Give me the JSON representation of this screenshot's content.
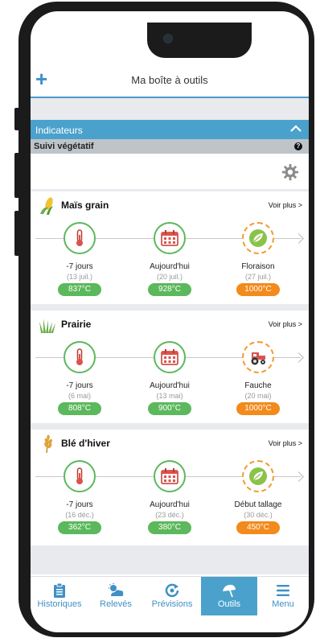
{
  "header": {
    "title": "Ma boîte à outils"
  },
  "section": {
    "title": "Indicateurs",
    "subtitle": "Suivi végétatif"
  },
  "cards": [
    {
      "crop": "Maïs grain",
      "voir_plus": "Voir plus >",
      "stages": [
        {
          "label": "-7 jours",
          "date": "(13 juil.)",
          "value": "837°C"
        },
        {
          "label": "Aujourd'hui",
          "date": "(20 juil.)",
          "value": "928°C"
        },
        {
          "label": "Floraison",
          "date": "(27 juil.)",
          "value": "1000°C"
        }
      ]
    },
    {
      "crop": "Prairie",
      "voir_plus": "Voir plus >",
      "stages": [
        {
          "label": "-7 jours",
          "date": "(6 mai)",
          "value": "808°C"
        },
        {
          "label": "Aujourd'hui",
          "date": "(13 mai)",
          "value": "900°C"
        },
        {
          "label": "Fauche",
          "date": "(20 mai)",
          "value": "1000°C"
        }
      ]
    },
    {
      "crop": "Blé d'hiver",
      "voir_plus": "Voir plus >",
      "stages": [
        {
          "label": "-7 jours",
          "date": "(16 déc.)",
          "value": "362°C"
        },
        {
          "label": "Aujourd'hui",
          "date": "(23 déc.)",
          "value": "380°C"
        },
        {
          "label": "Début tallage",
          "date": "(30 déc.)",
          "value": "450°C"
        }
      ]
    }
  ],
  "nav": [
    {
      "label": "Historiques",
      "icon": "clipboard-icon"
    },
    {
      "label": "Relevés",
      "icon": "weather-icon"
    },
    {
      "label": "Prévisions",
      "icon": "forecast-icon"
    },
    {
      "label": "Outils",
      "icon": "umbrella-icon",
      "active": true
    },
    {
      "label": "Menu",
      "icon": "menu-icon"
    }
  ],
  "colors": {
    "accent": "#4aa2cc",
    "green": "#5cb85c",
    "orange": "#f28a1c"
  }
}
